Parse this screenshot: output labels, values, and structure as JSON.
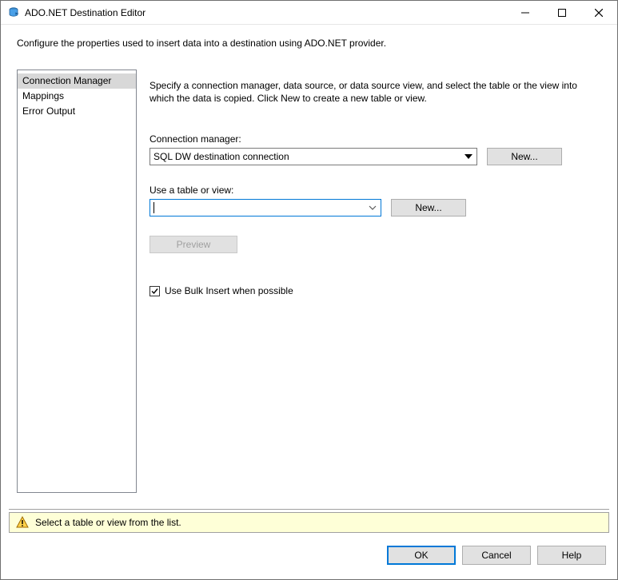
{
  "window": {
    "title": "ADO.NET Destination Editor"
  },
  "instruction": "Configure the properties used to insert data into a destination using ADO.NET provider.",
  "sidebar": {
    "items": [
      {
        "label": "Connection Manager",
        "selected": true
      },
      {
        "label": "Mappings",
        "selected": false
      },
      {
        "label": "Error Output",
        "selected": false
      }
    ]
  },
  "panel": {
    "description": "Specify a connection manager, data source, or data source view, and select the table or the view into which the data is copied. Click New to create a new table or view.",
    "connection": {
      "label": "Connection manager:",
      "value": "SQL DW destination connection",
      "new_button": "New..."
    },
    "table": {
      "label": "Use a table or view:",
      "value": "",
      "new_button": "New..."
    },
    "preview_button": "Preview",
    "bulk_insert": {
      "label": "Use Bulk Insert when possible",
      "checked": true
    }
  },
  "status": {
    "message": "Select a table or view from the list."
  },
  "footer": {
    "ok": "OK",
    "cancel": "Cancel",
    "help": "Help"
  }
}
